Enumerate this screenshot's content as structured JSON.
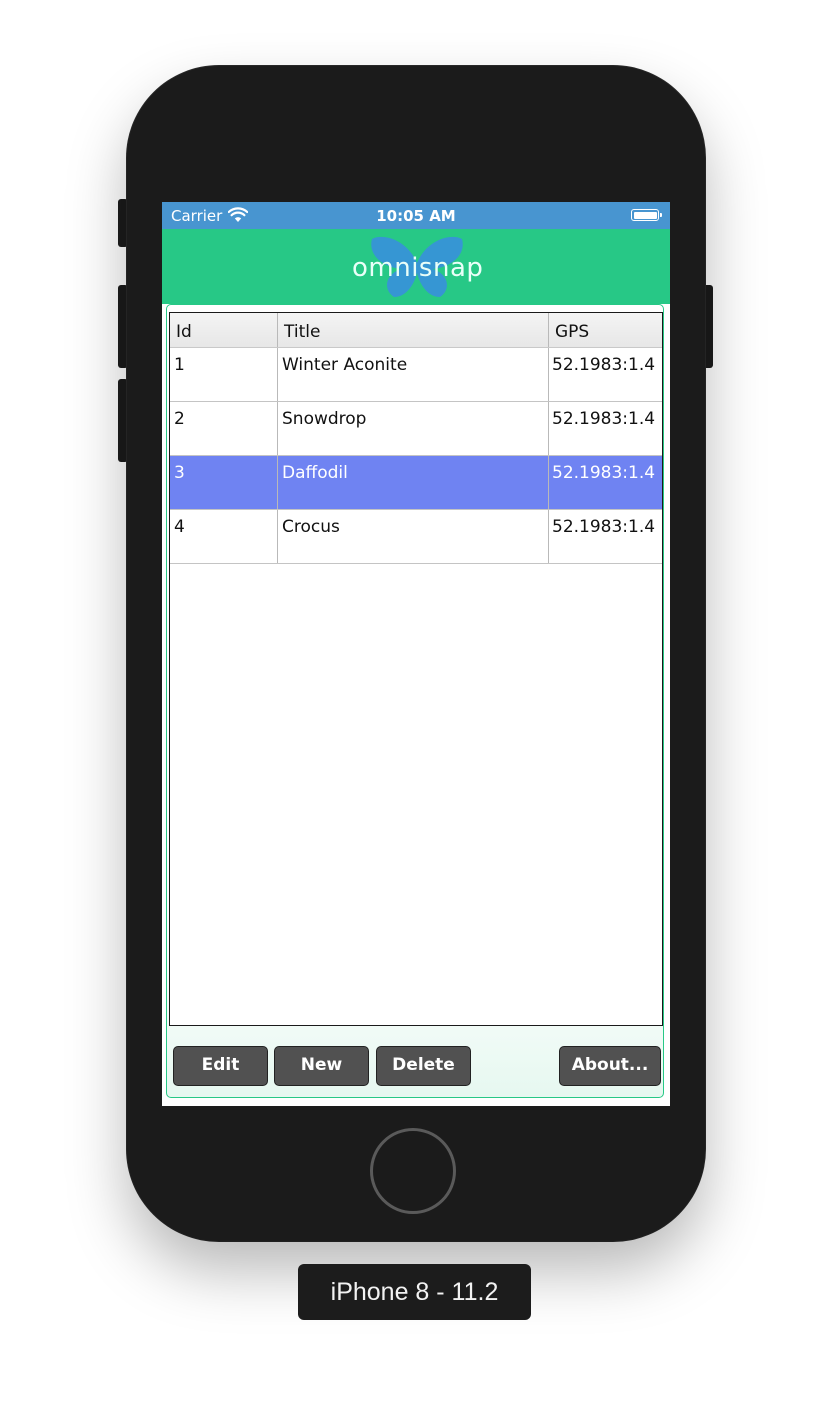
{
  "status_bar": {
    "carrier": "Carrier",
    "time": "10:05 AM"
  },
  "header": {
    "logo_text": "omnisnap",
    "background_color": "#27c886"
  },
  "table": {
    "columns": [
      "Id",
      "Title",
      "GPS"
    ],
    "rows": [
      {
        "id": "1",
        "title": "Winter Aconite",
        "gps": "52.1983:1.4"
      },
      {
        "id": "2",
        "title": "Snowdrop",
        "gps": "52.1983:1.4"
      },
      {
        "id": "3",
        "title": "Daffodil",
        "gps": "52.1983:1.4"
      },
      {
        "id": "4",
        "title": "Crocus",
        "gps": "52.1983:1.4"
      }
    ],
    "selected_row_id": "3",
    "selected_color": "#6f83f2"
  },
  "buttons": {
    "edit": "Edit",
    "new": "New",
    "delete": "Delete",
    "about": "About..."
  },
  "device_label": "iPhone 8 - 11.2"
}
